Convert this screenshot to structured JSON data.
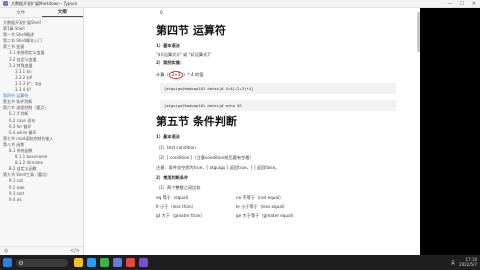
{
  "window": {
    "title": "大数据开发扩展Markdown - Typora",
    "minimize": "—",
    "maximize": "☐",
    "close": "✕"
  },
  "sidebar": {
    "tabs": [
      {
        "label": "文件"
      },
      {
        "label": "大纲"
      }
    ],
    "items": [
      {
        "label": "大数据开发扩展Shell",
        "level": 1
      },
      {
        "label": "第1章 Shell",
        "level": 1
      },
      {
        "label": "第一节 Shell概述",
        "level": 1
      },
      {
        "label": "第二节 Shell脚本入门",
        "level": 1
      },
      {
        "label": "第三节 变量",
        "level": 1
      },
      {
        "label": "3.1 系统预定义变量",
        "level": 2
      },
      {
        "label": "3.2 自定义变量",
        "level": 2
      },
      {
        "label": "3.3 特殊变量",
        "level": 2
      },
      {
        "label": "3.3.1 $n",
        "level": 3
      },
      {
        "label": "3.3.2 $#",
        "level": 3
      },
      {
        "label": "3.3.3 $*、$@",
        "level": 3
      },
      {
        "label": "3.3.4 $?",
        "level": 3
      },
      {
        "label": "第四节 运算符",
        "level": 1,
        "selected": true
      },
      {
        "label": "第五节 条件判断",
        "level": 1
      },
      {
        "label": "第六节 流程控制（重点）",
        "level": 1
      },
      {
        "label": "6.1 if 判断",
        "level": 2
      },
      {
        "label": "6.2 case 语句",
        "level": 2
      },
      {
        "label": "6.3 for 循环",
        "level": 2
      },
      {
        "label": "6.4 while 循环",
        "level": 2
      },
      {
        "label": "第七节 read读取控制台输入",
        "level": 1
      },
      {
        "label": "第八节 函数",
        "level": 1
      },
      {
        "label": "8.1 系统函数",
        "level": 2
      },
      {
        "label": "8.1.1 basename",
        "level": 3
      },
      {
        "label": "8.1.2 dirname",
        "level": 3
      },
      {
        "label": "8.2 自定义函数",
        "level": 2
      },
      {
        "label": "第九节 Shell工具（重点）",
        "level": 1
      },
      {
        "label": "9.1 cut",
        "level": 2
      },
      {
        "label": "9.2 awk",
        "level": 2
      },
      {
        "label": "9.3 sort",
        "level": 2
      },
      {
        "label": "9.4 wc",
        "level": 2
      }
    ],
    "bottom_left": "◎",
    "bottom_right": "</>"
  },
  "doc": {
    "top_line": "0",
    "sec4_title": "第四节 运算符",
    "sec4_syntax_head": "1）基本语法",
    "sec4_syntax": "\"$((运算式))\" 或 \"$[运算式]\"",
    "sec4_case_head": "2）案例实操：",
    "sec4_case_text_a": "计算（",
    "sec4_case_circ": "2+3",
    "sec4_case_text_b": "）* 4 的值",
    "sec4_code1": "[atguigu@hadoop101 datas]# S=$[(2+3)*4]",
    "sec4_code2": "[atguigu@hadoop101 datas]# echo $S",
    "sec5_title": "第五节 条件判断",
    "sec5_syntax_head": "1）基本语法",
    "sec5_line1": "（1）test condition",
    "sec5_line2": "（2）[ condition ]（注意condition前后要有空格）",
    "sec5_line3": "注意：条件非空即为true，[ atguigu ] 返回true，[ ] 返回false。",
    "sec5_common_head": "2）常用判断条件",
    "sec5_int_head": "（1）两个整数之间比较",
    "compare": [
      {
        "left": "eq 等于（equal）",
        "right": "ne 不等于（not equal）"
      },
      {
        "left": "lt 小于（less than）",
        "right": "le 小于等于（less equal）"
      },
      {
        "left": "gt 大于（greater than）",
        "right": "ge 大于等于（greater equal）"
      }
    ]
  },
  "taskbar": {
    "time": "17:10",
    "date": "2022/5/7",
    "lang": "英"
  }
}
